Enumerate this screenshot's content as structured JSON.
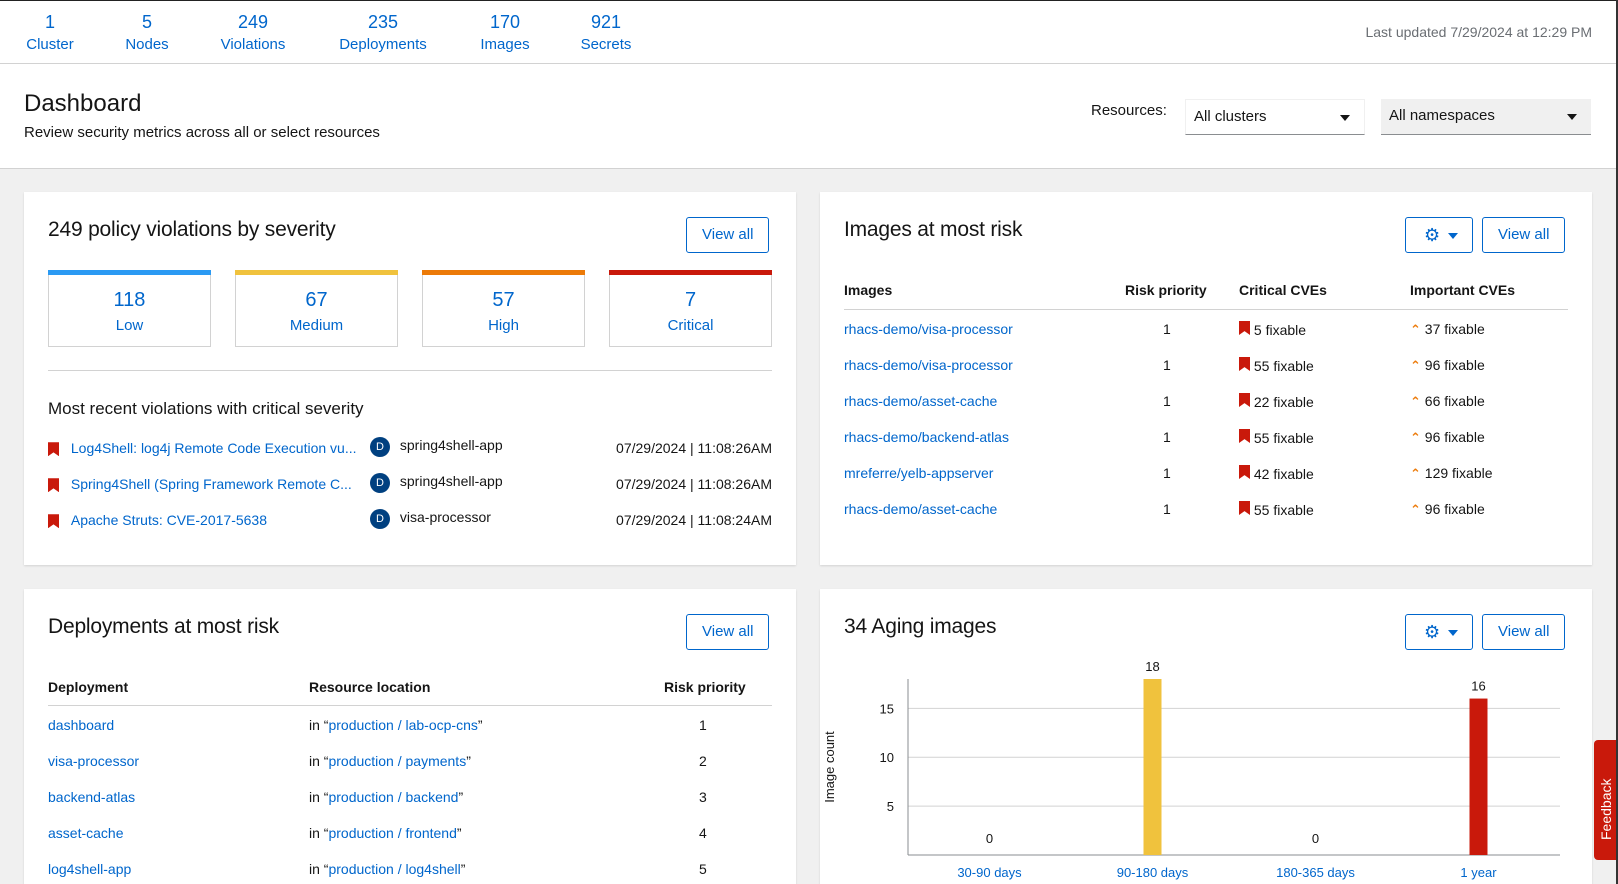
{
  "summary": {
    "items": [
      {
        "count": "1",
        "label": "Cluster"
      },
      {
        "count": "5",
        "label": "Nodes"
      },
      {
        "count": "249",
        "label": "Violations"
      },
      {
        "count": "235",
        "label": "Deployments"
      },
      {
        "count": "170",
        "label": "Images"
      },
      {
        "count": "921",
        "label": "Secrets"
      }
    ],
    "last_updated": "Last updated 7/29/2024 at 12:29 PM"
  },
  "header": {
    "title": "Dashboard",
    "description": "Review security metrics across all or select resources",
    "resources_label": "Resources:",
    "cluster_select": "All clusters",
    "namespace_select": "All namespaces"
  },
  "violations_card": {
    "title": "249 policy violations by severity",
    "view_all": "View all",
    "severities": [
      {
        "count": "118",
        "label": "Low",
        "color": "#2b9af3"
      },
      {
        "count": "67",
        "label": "Medium",
        "color": "#f0c23d"
      },
      {
        "count": "57",
        "label": "High",
        "color": "#ec7a08"
      },
      {
        "count": "7",
        "label": "Critical",
        "color": "#c9190b"
      }
    ],
    "recent_title": "Most recent violations with critical severity",
    "recent": [
      {
        "policy": "Log4Shell: log4j Remote Code Execution vu...",
        "badge": "D",
        "deployment": "spring4shell-app",
        "time": "07/29/2024 | 11:08:26AM"
      },
      {
        "policy": "Spring4Shell (Spring Framework Remote C...",
        "badge": "D",
        "deployment": "spring4shell-app",
        "time": "07/29/2024 | 11:08:26AM"
      },
      {
        "policy": "Apache Struts: CVE-2017-5638",
        "badge": "D",
        "deployment": "visa-processor",
        "time": "07/29/2024 | 11:08:24AM"
      }
    ]
  },
  "images_card": {
    "title": "Images at most risk",
    "view_all": "View all",
    "settings_icon": "gear-icon",
    "columns": [
      "Images",
      "Risk priority",
      "Critical CVEs",
      "Important CVEs"
    ],
    "rows": [
      {
        "image": "rhacs-demo/visa-processor",
        "priority": "1",
        "critical": "5 fixable",
        "important": "37 fixable"
      },
      {
        "image": "rhacs-demo/visa-processor",
        "priority": "1",
        "critical": "55 fixable",
        "important": "96 fixable"
      },
      {
        "image": "rhacs-demo/asset-cache",
        "priority": "1",
        "critical": "22 fixable",
        "important": "66 fixable"
      },
      {
        "image": "rhacs-demo/backend-atlas",
        "priority": "1",
        "critical": "55 fixable",
        "important": "96 fixable"
      },
      {
        "image": "mreferre/yelb-appserver",
        "priority": "1",
        "critical": "42 fixable",
        "important": "129 fixable"
      },
      {
        "image": "rhacs-demo/asset-cache",
        "priority": "1",
        "critical": "55 fixable",
        "important": "96 fixable"
      }
    ]
  },
  "deployments_card": {
    "title": "Deployments at most risk",
    "view_all": "View all",
    "columns": [
      "Deployment",
      "Resource location",
      "Risk priority"
    ],
    "in_prefix": "in “",
    "quote_suffix": "”",
    "rows": [
      {
        "name": "dashboard",
        "location": "production / lab-ocp-cns",
        "priority": "1"
      },
      {
        "name": "visa-processor",
        "location": "production / payments",
        "priority": "2"
      },
      {
        "name": "backend-atlas",
        "location": "production / backend",
        "priority": "3"
      },
      {
        "name": "asset-cache",
        "location": "production / frontend",
        "priority": "4"
      },
      {
        "name": "log4shell-app",
        "location": "production / log4shell",
        "priority": "5"
      }
    ]
  },
  "aging_card": {
    "title": "34 Aging images",
    "view_all": "View all",
    "settings_icon": "gear-icon"
  },
  "chart_data": {
    "type": "bar",
    "categories": [
      "30-90 days",
      "90-180 days",
      "180-365 days",
      "1 year"
    ],
    "values": [
      0,
      18,
      0,
      16
    ],
    "colors": [
      "#f0c23d",
      "#f0c23d",
      "#ec7a08",
      "#c9190b"
    ],
    "ylabel": "Image count",
    "yticks": [
      5,
      10,
      15
    ],
    "ylim": [
      0,
      18
    ]
  },
  "feedback": {
    "label": "Feedback"
  }
}
